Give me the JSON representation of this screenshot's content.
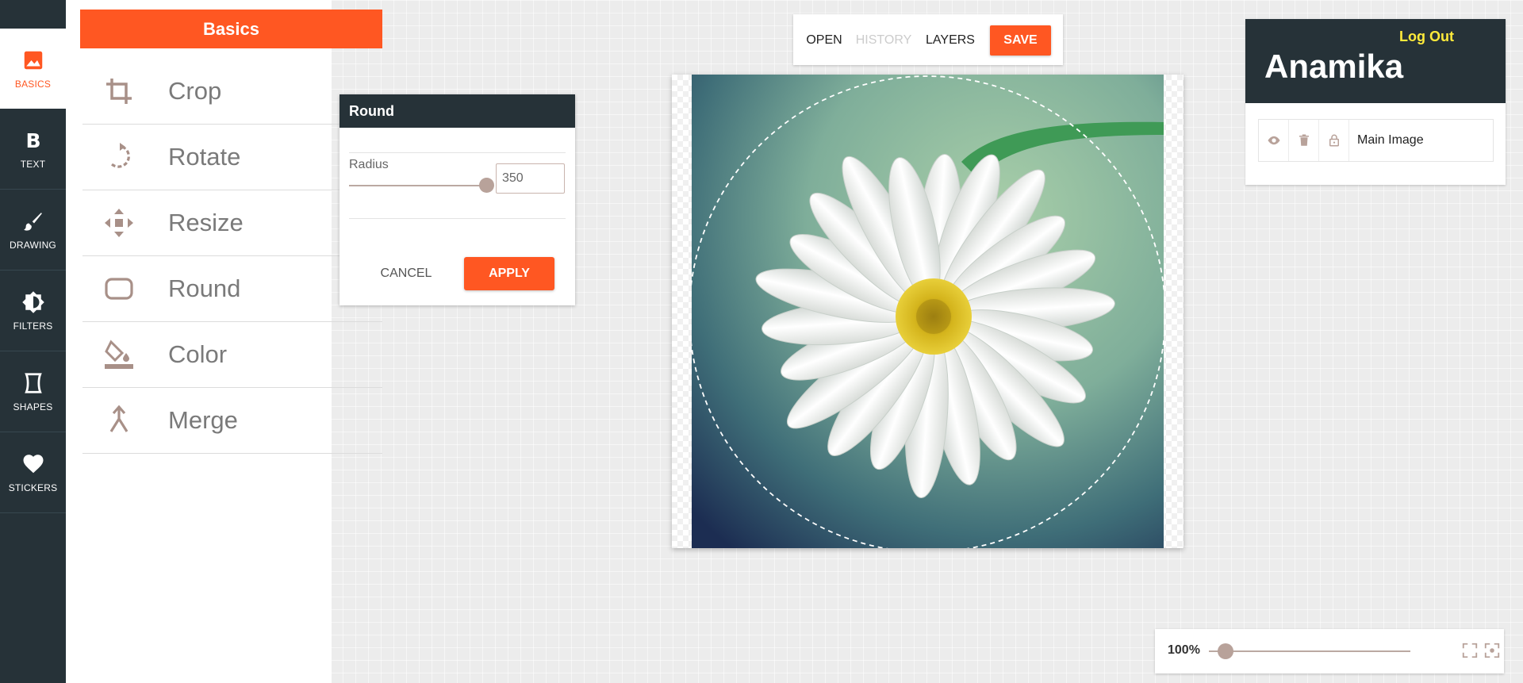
{
  "colors": {
    "accent": "#ff5722",
    "dark": "#263238",
    "highlight": "#ffeb3b",
    "muted": "#b8a29a"
  },
  "nav": {
    "items": [
      {
        "label": "BASICS",
        "icon": "image-icon",
        "active": true
      },
      {
        "label": "TEXT",
        "icon": "bold-icon"
      },
      {
        "label": "DRAWING",
        "icon": "brush-icon"
      },
      {
        "label": "FILTERS",
        "icon": "contrast-icon"
      },
      {
        "label": "SHAPES",
        "icon": "shape-icon"
      },
      {
        "label": "STICKERS",
        "icon": "heart-icon"
      }
    ]
  },
  "panel": {
    "title": "Basics",
    "tools": [
      {
        "label": "Crop",
        "icon": "crop-icon"
      },
      {
        "label": "Rotate",
        "icon": "rotate-icon"
      },
      {
        "label": "Resize",
        "icon": "resize-icon"
      },
      {
        "label": "Round",
        "icon": "rounded-rect-icon"
      },
      {
        "label": "Color",
        "icon": "paint-bucket-icon"
      },
      {
        "label": "Merge",
        "icon": "merge-icon"
      }
    ]
  },
  "round_dialog": {
    "title": "Round",
    "radius_label": "Radius",
    "radius_value": "350",
    "slider_fraction": 1.0,
    "cancel_label": "CANCEL",
    "apply_label": "APPLY"
  },
  "toolbar": {
    "open": "OPEN",
    "history": "HISTORY",
    "layers": "LAYERS",
    "save": "SAVE"
  },
  "account": {
    "logout": "Log Out",
    "user_name": "Anamika"
  },
  "layers": [
    {
      "name": "Main Image",
      "icons": [
        "eye-icon",
        "trash-icon",
        "lock-icon"
      ]
    }
  ],
  "zoom": {
    "label": "100%",
    "percent": 100,
    "icons": [
      "fit-screen-icon",
      "center-focus-icon"
    ]
  }
}
